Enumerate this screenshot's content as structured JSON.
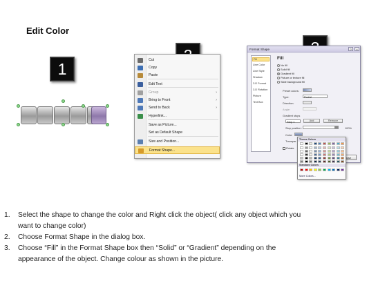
{
  "title": "Edit Color",
  "steps": [
    "1",
    "2",
    "3"
  ],
  "context_menu": {
    "items": [
      {
        "label": "Cut",
        "disabled": false,
        "submenu": false,
        "highlight": false,
        "icon": "scissors-icon",
        "color": "#6b6b6b"
      },
      {
        "label": "Copy",
        "disabled": false,
        "submenu": false,
        "highlight": false,
        "icon": "copy-icon",
        "color": "#3d6fb4"
      },
      {
        "label": "Paste",
        "disabled": false,
        "submenu": false,
        "highlight": false,
        "icon": "paste-icon",
        "color": "#b78a3a"
      },
      {
        "label": "Edit Text",
        "disabled": false,
        "submenu": false,
        "highlight": false,
        "icon": "edit-text-icon",
        "color": "#3a5f9e"
      },
      {
        "label": "Group",
        "disabled": true,
        "submenu": true,
        "highlight": false,
        "icon": "group-icon",
        "color": "#a0a0a0"
      },
      {
        "label": "Bring to Front",
        "disabled": false,
        "submenu": true,
        "highlight": false,
        "icon": "bring-to-front-icon",
        "color": "#4e79b8"
      },
      {
        "label": "Send to Back",
        "disabled": false,
        "submenu": true,
        "highlight": false,
        "icon": "send-to-back-icon",
        "color": "#4e79b8"
      },
      {
        "label": "Hyperlink...",
        "disabled": false,
        "submenu": false,
        "highlight": false,
        "icon": "globe-icon",
        "color": "#3a8f4a"
      },
      {
        "label": "Save as Picture...",
        "disabled": false,
        "submenu": false,
        "highlight": false,
        "icon": "",
        "color": ""
      },
      {
        "label": "Set as Default Shape",
        "disabled": false,
        "submenu": false,
        "highlight": false,
        "icon": "",
        "color": ""
      },
      {
        "label": "Size and Position...",
        "disabled": false,
        "submenu": false,
        "highlight": false,
        "icon": "size-position-icon",
        "color": "#5b7fb0"
      },
      {
        "label": "Format Shape...",
        "disabled": false,
        "submenu": false,
        "highlight": true,
        "icon": "format-shape-icon",
        "color": "#d69a2a"
      }
    ]
  },
  "dialog": {
    "title": "Format Shape",
    "categories": [
      "Fill",
      "Line Color",
      "Line Style",
      "Shadow",
      "3-D Format",
      "3-D Rotation",
      "Picture",
      "Text Box"
    ],
    "selected_category": "Fill",
    "fill_heading": "Fill",
    "fill_options": [
      "No fill",
      "Solid fill",
      "Gradient fill",
      "Picture or texture fill",
      "Slide background fill"
    ],
    "selected_fill": "Gradient fill",
    "preset_label": "Preset colors:",
    "type_label": "Type:",
    "type_value": "Radial",
    "direction_label": "Direction:",
    "angle_label": "Angle:",
    "gradient_stops_label": "Gradient stops",
    "stop_value": "Stop 1",
    "add_label": "Add",
    "remove_label": "Remove",
    "stop_position_label": "Stop position:",
    "stop_position_value": "100%",
    "color_label": "Color:",
    "transparency_label": "Transpar",
    "rotate_label": "Rotate",
    "close_label": "Close"
  },
  "palette": {
    "theme_heading": "Theme Colors",
    "standard_heading": "Standard Colors",
    "more_label": "More Colors...",
    "theme_colors": [
      "#ffffff",
      "#000000",
      "#eeece1",
      "#1f497d",
      "#4f81bd",
      "#c0504d",
      "#9bbb59",
      "#8064a2",
      "#4bacc6",
      "#f79646"
    ],
    "standard_colors": [
      "#c00000",
      "#ff0000",
      "#ffc000",
      "#ffff00",
      "#92d050",
      "#00b050",
      "#00b0f0",
      "#0070c0",
      "#002060",
      "#7030a0"
    ]
  },
  "instructions": [
    {
      "num": "1.",
      "lines": [
        "Select the shape to change the color and Right click the object( click any object which you",
        "want to change color)"
      ]
    },
    {
      "num": "2.",
      "lines": [
        "Choose Format Shape in the dialog box."
      ]
    },
    {
      "num": "3.",
      "lines": [
        "Choose “Fill” in the Format Shape box then “Solid” or “Gradient” depending on the",
        "appearance of the object. Change colour as shown in the picture."
      ]
    }
  ]
}
